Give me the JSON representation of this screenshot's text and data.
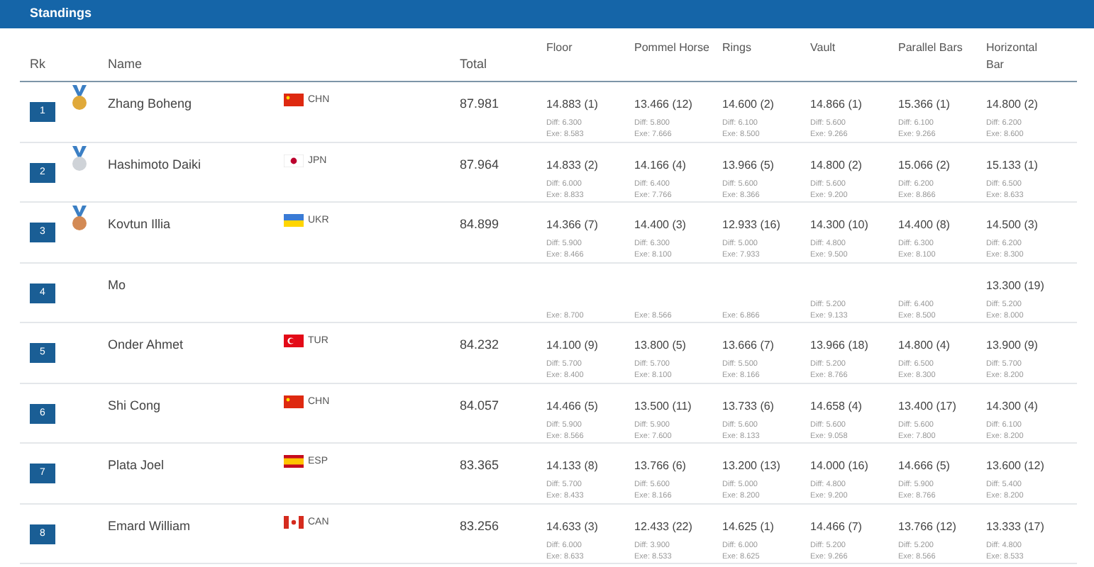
{
  "header": {
    "title": "Standings"
  },
  "columns": [
    "Rk",
    "Name",
    "Total",
    "Floor",
    "Pommel Horse",
    "Rings",
    "Vault",
    "Parallel Bars",
    "Horizontal Bar"
  ],
  "rows": [
    {
      "rank": "1",
      "medal": {
        "kind": "gold"
      },
      "name": "Zhang Boheng",
      "flag": {
        "kind": "cn"
      },
      "country": "CHN",
      "total": "87.981",
      "scores": [
        {
          "score": "14.883 (1)",
          "diff": "Diff: 6.300",
          "exe": "Exe: 8.583"
        },
        {
          "score": "13.466 (12)",
          "diff": "Diff: 5.800",
          "exe": "Exe: 7.666"
        },
        {
          "score": "14.600 (2)",
          "diff": "Diff: 6.100",
          "exe": "Exe: 8.500"
        },
        {
          "score": "14.866 (1)",
          "diff": "Diff: 5.600",
          "exe": "Exe: 9.266"
        },
        {
          "score": "15.366 (1)",
          "diff": "Diff: 6.100",
          "exe": "Exe: 9.266"
        },
        {
          "score": "14.800 (2)",
          "diff": "Diff: 6.200",
          "exe": "Exe: 8.600"
        }
      ]
    },
    {
      "rank": "2",
      "medal": {
        "kind": "silver"
      },
      "name": "Hashimoto Daiki",
      "flag": {
        "kind": "jp"
      },
      "country": "JPN",
      "total": "87.964",
      "scores": [
        {
          "score": "14.833 (2)",
          "diff": "Diff: 6.000",
          "exe": "Exe: 8.833"
        },
        {
          "score": "14.166 (4)",
          "diff": "Diff: 6.400",
          "exe": "Exe: 7.766"
        },
        {
          "score": "13.966 (5)",
          "diff": "Diff: 5.600",
          "exe": "Exe: 8.366"
        },
        {
          "score": "14.800 (2)",
          "diff": "Diff: 5.600",
          "exe": "Exe: 9.200"
        },
        {
          "score": "15.066 (2)",
          "diff": "Diff: 6.200",
          "exe": "Exe: 8.866"
        },
        {
          "score": "15.133 (1)",
          "diff": "Diff: 6.500",
          "exe": "Exe: 8.633"
        }
      ]
    },
    {
      "rank": "3",
      "medal": {
        "kind": "bronze"
      },
      "name": "Kovtun Illia",
      "flag": {
        "kind": "ua"
      },
      "country": "UKR",
      "total": "84.899",
      "scores": [
        {
          "score": "14.366 (7)",
          "diff": "Diff: 5.900",
          "exe": "Exe: 8.466"
        },
        {
          "score": "14.400 (3)",
          "diff": "Diff: 6.300",
          "exe": "Exe: 8.100"
        },
        {
          "score": "12.933 (16)",
          "diff": "Diff: 5.000",
          "exe": "Exe: 7.933"
        },
        {
          "score": "14.300 (10)",
          "diff": "Diff: 4.800",
          "exe": "Exe: 9.500"
        },
        {
          "score": "14.400 (8)",
          "diff": "Diff: 6.300",
          "exe": "Exe: 8.100"
        },
        {
          "score": "14.500 (3)",
          "diff": "Diff: 6.200",
          "exe": "Exe: 8.300"
        }
      ]
    },
    {
      "rank": "4",
      "name": "Mo",
      "scores": [
        {
          "exe": "Exe: 8.700"
        },
        {
          "exe": "Exe: 8.566"
        },
        {
          "exe": "Exe: 6.866"
        },
        {
          "diff": "Diff: 5.200",
          "exe": "Exe: 9.133"
        },
        {
          "diff": "Diff: 6.400",
          "exe": "Exe: 8.500"
        },
        {
          "score": "13.300 (19)",
          "diff": "Diff: 5.200",
          "exe": "Exe: 8.000"
        }
      ]
    },
    {
      "rank": "5",
      "name": "Onder Ahmet",
      "flag": {
        "kind": "tr"
      },
      "country": "TUR",
      "total": "84.232",
      "scores": [
        {
          "score": "14.100 (9)",
          "diff": "Diff: 5.700",
          "exe": "Exe: 8.400"
        },
        {
          "score": "13.800 (5)",
          "diff": "Diff: 5.700",
          "exe": "Exe: 8.100"
        },
        {
          "score": "13.666 (7)",
          "diff": "Diff: 5.500",
          "exe": "Exe: 8.166"
        },
        {
          "score": "13.966 (18)",
          "diff": "Diff: 5.200",
          "exe": "Exe: 8.766"
        },
        {
          "score": "14.800 (4)",
          "diff": "Diff: 6.500",
          "exe": "Exe: 8.300"
        },
        {
          "score": "13.900 (9)",
          "diff": "Diff: 5.700",
          "exe": "Exe: 8.200"
        }
      ]
    },
    {
      "rank": "6",
      "name": "Shi Cong",
      "flag": {
        "kind": "cn"
      },
      "country": "CHN",
      "total": "84.057",
      "scores": [
        {
          "score": "14.466 (5)",
          "diff": "Diff: 5.900",
          "exe": "Exe: 8.566"
        },
        {
          "score": "13.500 (11)",
          "diff": "Diff: 5.900",
          "exe": "Exe: 7.600"
        },
        {
          "score": "13.733 (6)",
          "diff": "Diff: 5.600",
          "exe": "Exe: 8.133"
        },
        {
          "score": "14.658 (4)",
          "diff": "Diff: 5.600",
          "exe": "Exe: 9.058"
        },
        {
          "score": "13.400 (17)",
          "diff": "Diff: 5.600",
          "exe": "Exe: 7.800"
        },
        {
          "score": "14.300 (4)",
          "diff": "Diff: 6.100",
          "exe": "Exe: 8.200"
        }
      ]
    },
    {
      "rank": "7",
      "name": "Plata Joel",
      "flag": {
        "kind": "es"
      },
      "country": "ESP",
      "total": "83.365",
      "scores": [
        {
          "score": "14.133 (8)",
          "diff": "Diff: 5.700",
          "exe": "Exe: 8.433"
        },
        {
          "score": "13.766 (6)",
          "diff": "Diff: 5.600",
          "exe": "Exe: 8.166"
        },
        {
          "score": "13.200 (13)",
          "diff": "Diff: 5.000",
          "exe": "Exe: 8.200"
        },
        {
          "score": "14.000 (16)",
          "diff": "Diff: 4.800",
          "exe": "Exe: 9.200"
        },
        {
          "score": "14.666 (5)",
          "diff": "Diff: 5.900",
          "exe": "Exe: 8.766"
        },
        {
          "score": "13.600 (12)",
          "diff": "Diff: 5.400",
          "exe": "Exe: 8.200"
        }
      ]
    },
    {
      "rank": "8",
      "name": "Emard William",
      "flag": {
        "kind": "ca"
      },
      "country": "CAN",
      "total": "83.256",
      "scores": [
        {
          "score": "14.633 (3)",
          "diff": "Diff: 6.000",
          "exe": "Exe: 8.633"
        },
        {
          "score": "12.433 (22)",
          "diff": "Diff: 3.900",
          "exe": "Exe: 8.533"
        },
        {
          "score": "14.625 (1)",
          "diff": "Diff: 6.000",
          "exe": "Exe: 8.625"
        },
        {
          "score": "14.466 (7)",
          "diff": "Diff: 5.200",
          "exe": "Exe: 9.266"
        },
        {
          "score": "13.766 (12)",
          "diff": "Diff: 5.200",
          "exe": "Exe: 8.566"
        },
        {
          "score": "13.333 (17)",
          "diff": "Diff: 4.800",
          "exe": "Exe: 8.533"
        }
      ]
    }
  ]
}
